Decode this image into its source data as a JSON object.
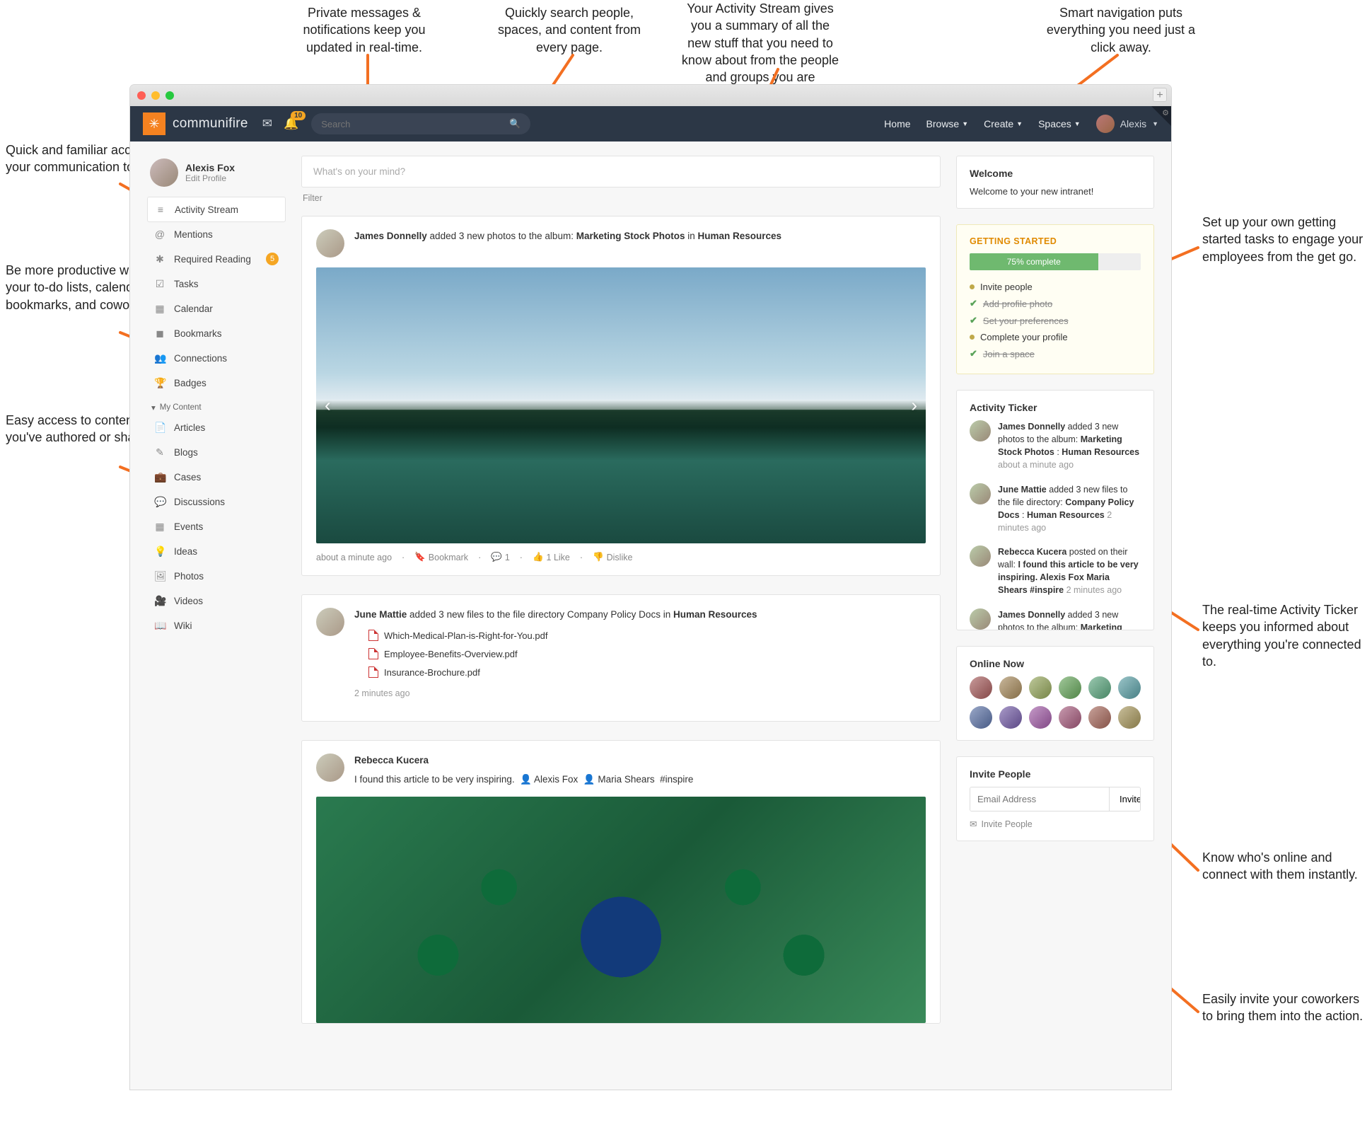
{
  "callouts": {
    "messages": "Private messages & notifications keep you updated in real-time.",
    "search": "Quickly search people, spaces, and content from every page.",
    "stream": "Your Activity Stream gives you a summary of all the new stuff that you need to know about from the people and groups you are connected to.",
    "nav": "Smart navigation puts everything you need just a click away.",
    "tools": "Quick and familiar access to your communication tools.",
    "productive": "Be more productive with your to-do lists, calendars, bookmarks, and coworkers.",
    "content": "Easy access to content that you've authored or shared.",
    "getstarted": "Set up your own getting started tasks to engage your employees from the get go.",
    "ticker": "The real-time Activity Ticker keeps you informed about everything you're connected to.",
    "online": "Know who's online and connect with them instantly.",
    "invite": "Easily invite your coworkers to bring them into the action."
  },
  "brand": "communifire",
  "notif_count": "10",
  "search_placeholder": "Search",
  "nav": {
    "home": "Home",
    "browse": "Browse",
    "create": "Create",
    "spaces": "Spaces",
    "user": "Alexis"
  },
  "profile": {
    "name": "Alexis Fox",
    "sub": "Edit Profile"
  },
  "sidebar": {
    "items": [
      {
        "icon": "≡",
        "label": "Activity Stream",
        "active": true
      },
      {
        "icon": "@",
        "label": "Mentions"
      },
      {
        "icon": "✱",
        "label": "Required Reading",
        "badge": "5"
      },
      {
        "icon": "☑",
        "label": "Tasks"
      },
      {
        "icon": "▦",
        "label": "Calendar"
      },
      {
        "icon": "◼",
        "label": "Bookmarks"
      },
      {
        "icon": "👥",
        "label": "Connections"
      },
      {
        "icon": "🏆",
        "label": "Badges"
      }
    ],
    "section": "My Content",
    "content": [
      {
        "icon": "📄",
        "label": "Articles"
      },
      {
        "icon": "✎",
        "label": "Blogs"
      },
      {
        "icon": "💼",
        "label": "Cases"
      },
      {
        "icon": "💬",
        "label": "Discussions"
      },
      {
        "icon": "▦",
        "label": "Events"
      },
      {
        "icon": "💡",
        "label": "Ideas"
      },
      {
        "icon": "🖼",
        "label": "Photos"
      },
      {
        "icon": "🎥",
        "label": "Videos"
      },
      {
        "icon": "📖",
        "label": "Wiki"
      }
    ]
  },
  "composer_placeholder": "What's on your mind?",
  "filter": "Filter",
  "post1": {
    "author": "James Donnelly",
    "verb": " added 3 new photos to the album: ",
    "album": "Marketing Stock Photos",
    "in": " in ",
    "space": "Human Resources",
    "time": "about a minute ago",
    "bookmark": "Bookmark",
    "comments": "1",
    "likes": "1  Like",
    "dislike": "Dislike"
  },
  "post2": {
    "author": "June Mattie",
    "verb": " added 3 new files to the file directory Company Policy Docs in ",
    "space": "Human Resources",
    "files": [
      "Which-Medical-Plan-is-Right-for-You.pdf",
      "Employee-Benefits-Overview.pdf",
      "Insurance-Brochure.pdf"
    ],
    "time": "2 minutes ago"
  },
  "post3": {
    "author": "Rebecca Kucera",
    "body": "I found this article to be very inspiring.",
    "tag1": "Alexis Fox",
    "tag2": "Maria Shears",
    "hash": "#inspire"
  },
  "welcome": {
    "title": "Welcome",
    "body": "Welcome to your new intranet!"
  },
  "gs": {
    "title": "GETTING STARTED",
    "pct": "75% complete",
    "pct_width": "75%",
    "items": [
      {
        "label": "Invite people",
        "done": false
      },
      {
        "label": "Add profile photo",
        "done": true
      },
      {
        "label": "Set your preferences",
        "done": true
      },
      {
        "label": "Complete your profile",
        "done": false
      },
      {
        "label": "Join a space",
        "done": true
      }
    ]
  },
  "ticker": {
    "title": "Activity Ticker",
    "items": [
      {
        "who": "James Donnelly",
        "text": " added 3 new photos to the album: ",
        "b1": "Marketing Stock Photos",
        "sep": " : ",
        "b2": "Human Resources",
        "time": "about a minute ago"
      },
      {
        "who": "June Mattie",
        "text": " added 3 new files to the file directory: ",
        "b1": "Company Policy Docs",
        "sep": " : ",
        "b2": "Human Resources",
        "time": "2 minutes ago"
      },
      {
        "who": "Rebecca Kucera",
        "text": " posted on their wall: ",
        "b1": "I found this article to be very inspiring. Alexis Fox Maria Shears #inspire",
        "sep": "",
        "b2": "",
        "time": "2 minutes ago"
      },
      {
        "who": "James Donnelly",
        "text": " added 3 new photos to the album: ",
        "b1": "Marketing",
        "sep": "",
        "b2": "",
        "time": ""
      }
    ]
  },
  "online": {
    "title": "Online Now",
    "count": 12
  },
  "invite": {
    "title": "Invite People",
    "placeholder": "Email Address",
    "btn": "Invite",
    "link": "Invite People"
  }
}
